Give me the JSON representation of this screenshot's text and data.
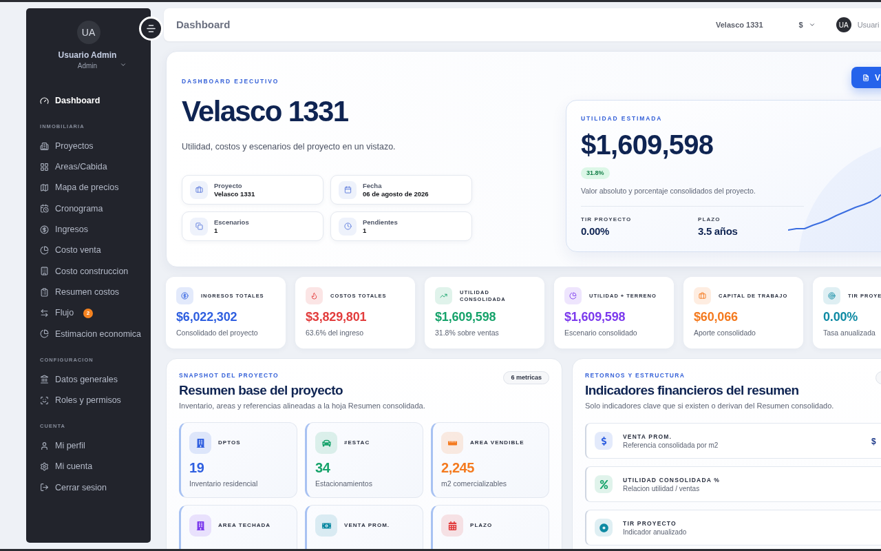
{
  "sidebar": {
    "user": {
      "initials": "UA",
      "name": "Usuario Admin",
      "role": "Admin"
    },
    "sections": [
      {
        "items": [
          {
            "label": "Dashboard",
            "selected": true
          }
        ]
      },
      {
        "title": "INMOBILIARIA",
        "items": [
          {
            "label": "Proyectos",
            "selected": false
          },
          {
            "label": "Areas/Cabida",
            "selected": false
          },
          {
            "label": "Mapa de precios",
            "selected": false
          },
          {
            "label": "Cronograma",
            "selected": false
          },
          {
            "label": "Ingresos",
            "selected": false
          },
          {
            "label": "Costo venta",
            "selected": false
          },
          {
            "label": "Costo construccion",
            "selected": false
          },
          {
            "label": "Resumen costos",
            "selected": false
          },
          {
            "label": "Flujo",
            "selected": false,
            "badge": "2"
          },
          {
            "label": "Estimacion economica",
            "selected": false
          }
        ]
      },
      {
        "title": "CONFIGURACION",
        "items": [
          {
            "label": "Datos generales",
            "selected": false
          },
          {
            "label": "Roles y permisos",
            "selected": false
          }
        ]
      },
      {
        "title": "CUENTA",
        "items": [
          {
            "label": "Mi perfil",
            "selected": false
          },
          {
            "label": "Mi cuenta",
            "selected": false
          },
          {
            "label": "Cerrar sesion",
            "selected": false
          }
        ]
      }
    ]
  },
  "header": {
    "title": "Dashboard",
    "project": "Velasco 1331",
    "currency": "$",
    "user": {
      "initials": "UA",
      "name": "Usuari"
    }
  },
  "hero": {
    "eyebrow": "DASHBOARD EJECUTIVO",
    "title": "Velasco 1331",
    "subtitle": "Utilidad, costos y escenarios del proyecto en un vistazo.",
    "facts": [
      {
        "label": "Proyecto",
        "value": "Velasco 1331"
      },
      {
        "label": "Fecha",
        "value": "06 de agosto de 2026"
      },
      {
        "label": "Escenarios",
        "value": "1"
      },
      {
        "label": "Pendientes",
        "value": "1"
      }
    ],
    "button": "V"
  },
  "profit_card": {
    "eyebrow": "UTILIDAD ESTIMADA",
    "value": "$1,609,598",
    "badge": "31.8%",
    "description": "Valor absoluto y porcentaje consolidados del proyecto.",
    "stats": [
      {
        "label": "TIR PROYECTO",
        "value": "0.00%"
      },
      {
        "label": "PLAZO",
        "value": "3.5 años"
      }
    ]
  },
  "kpis": [
    {
      "label": "INGRESOS TOTALES",
      "value": "$6,022,302",
      "note": "Consolidado del proyecto",
      "color": "#2f5fe0"
    },
    {
      "label": "COSTOS TOTALES",
      "value": "$3,829,801",
      "note": "63.6% del ingreso",
      "color": "#e23d3d"
    },
    {
      "label": "UTILIDAD CONSOLIDADA",
      "value": "$1,609,598",
      "note": "31.8% sobre ventas",
      "color": "#17a36b"
    },
    {
      "label": "UTILIDAD + TERRENO",
      "value": "$1,609,598",
      "note": "Escenario consolidado",
      "color": "#7c3aed"
    },
    {
      "label": "CAPITAL DE TRABAJO",
      "value": "$60,066",
      "note": "Aporte consolidado",
      "color": "#f47a1f"
    },
    {
      "label": "TIR PROYE",
      "value": "0.00%",
      "note": "Tasa anualizada",
      "color": "#0e8aa3"
    }
  ],
  "snapshot": {
    "eyebrow": "SNAPSHOT DEL PROYECTO",
    "badge": "6 metricas",
    "title": "Resumen base del proyecto",
    "description": "Inventario, areas y referencias alineadas a la hoja Resumen consolidada.",
    "metrics": [
      {
        "label": "DPTOS",
        "value": "19",
        "note": "Inventario residencial",
        "color": "#2f5fe0"
      },
      {
        "label": "#ESTAC",
        "value": "34",
        "note": "Estacionamientos",
        "color": "#17a36b"
      },
      {
        "label": "AREA VENDIBLE",
        "value": "2,245",
        "note": "m2 comercializables",
        "color": "#f47a1f"
      },
      {
        "label": "AREA TECHADA",
        "color": "#7c3aed"
      },
      {
        "label": "VENTA PROM.",
        "color": "#0e8aa3"
      },
      {
        "label": "PLAZO",
        "color": "#e23d3d"
      }
    ]
  },
  "financials": {
    "eyebrow": "RETORNOS Y ESTRUCTURA",
    "title": "Indicadores financieros del resumen",
    "description": "Solo indicadores clave que si existen o derivan del Resumen consolidado.",
    "rows": [
      {
        "label": "VENTA PROM.",
        "note": "Referencia consolidada por m2",
        "value": "$",
        "color": "#2f5fe0"
      },
      {
        "label": "UTILIDAD CONSOLIDADA %",
        "note": "Relacion utilidad / ventas",
        "color": "#17a36b"
      },
      {
        "label": "TIR PROYECTO",
        "note": "Indicador anualizado",
        "color": "#0e8aa3"
      }
    ]
  }
}
